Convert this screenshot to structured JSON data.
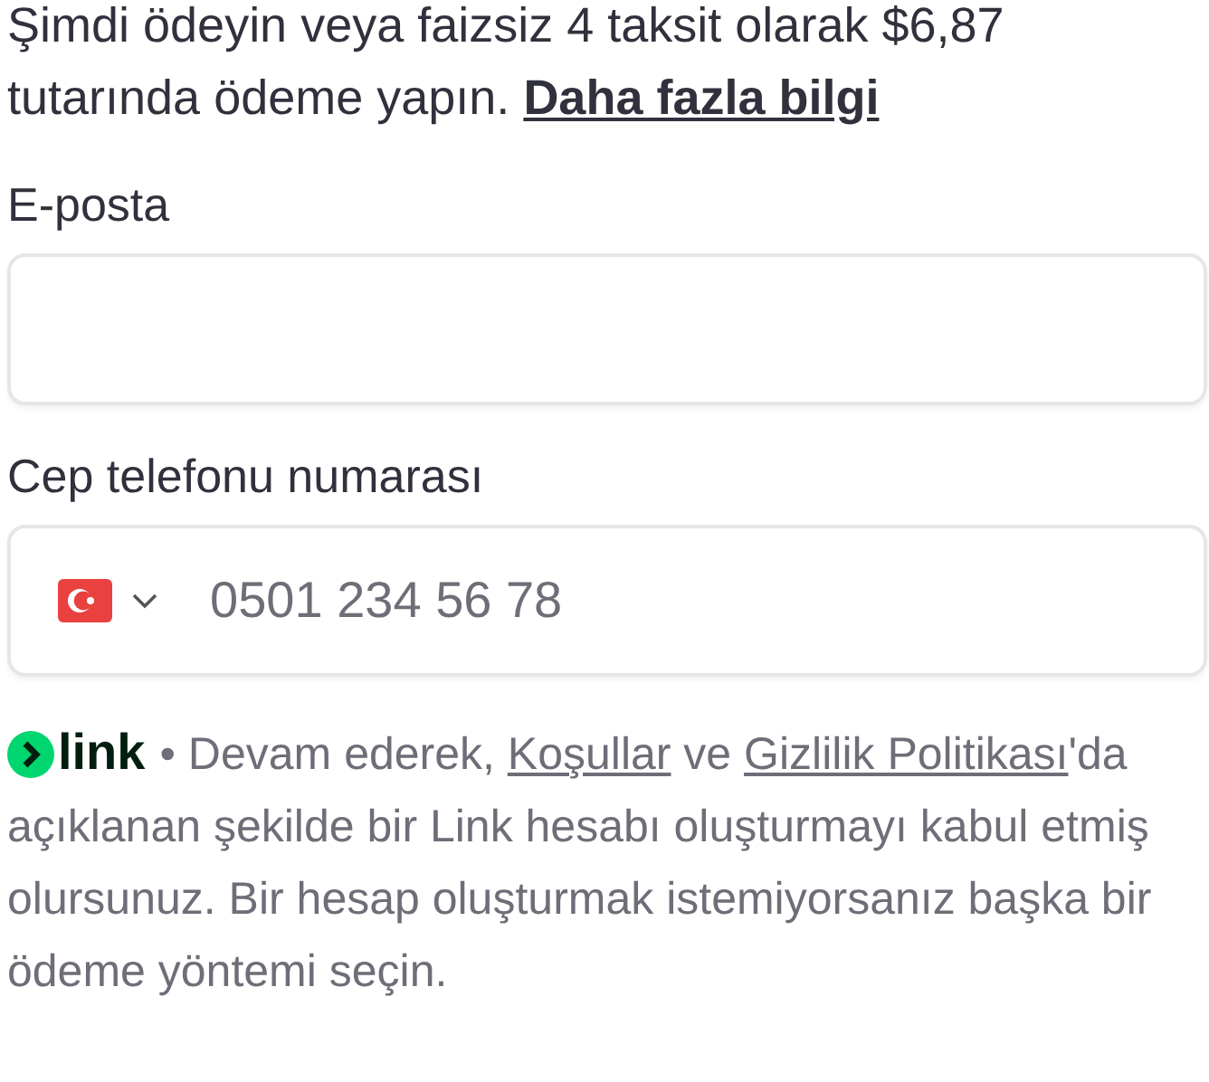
{
  "installments": {
    "text": "Şimdi ödeyin veya faizsiz 4 taksit olarak $6,87 tutarında ödeme yapın.",
    "link": "Daha fazla bilgi"
  },
  "email": {
    "label": "E-posta"
  },
  "phone": {
    "label": "Cep telefonu numarası",
    "placeholder": "0501 234 56 78"
  },
  "link_notice": {
    "logo": "link",
    "parts": [
      {
        "kind": "text",
        "text": "• Devam ederek, "
      },
      {
        "kind": "link",
        "text": "Koşullar"
      },
      {
        "kind": "text",
        "text": " ve "
      },
      {
        "kind": "link",
        "text": "Gizlilik Politikası"
      },
      {
        "kind": "text",
        "text": "'da açıklanan şekilde bir Link hesabı oluşturmayı kabul etmiş olursunuz. Bir hesap oluşturmak istemiyorsanız başka bir ödeme yöntemi seçin."
      }
    ]
  }
}
